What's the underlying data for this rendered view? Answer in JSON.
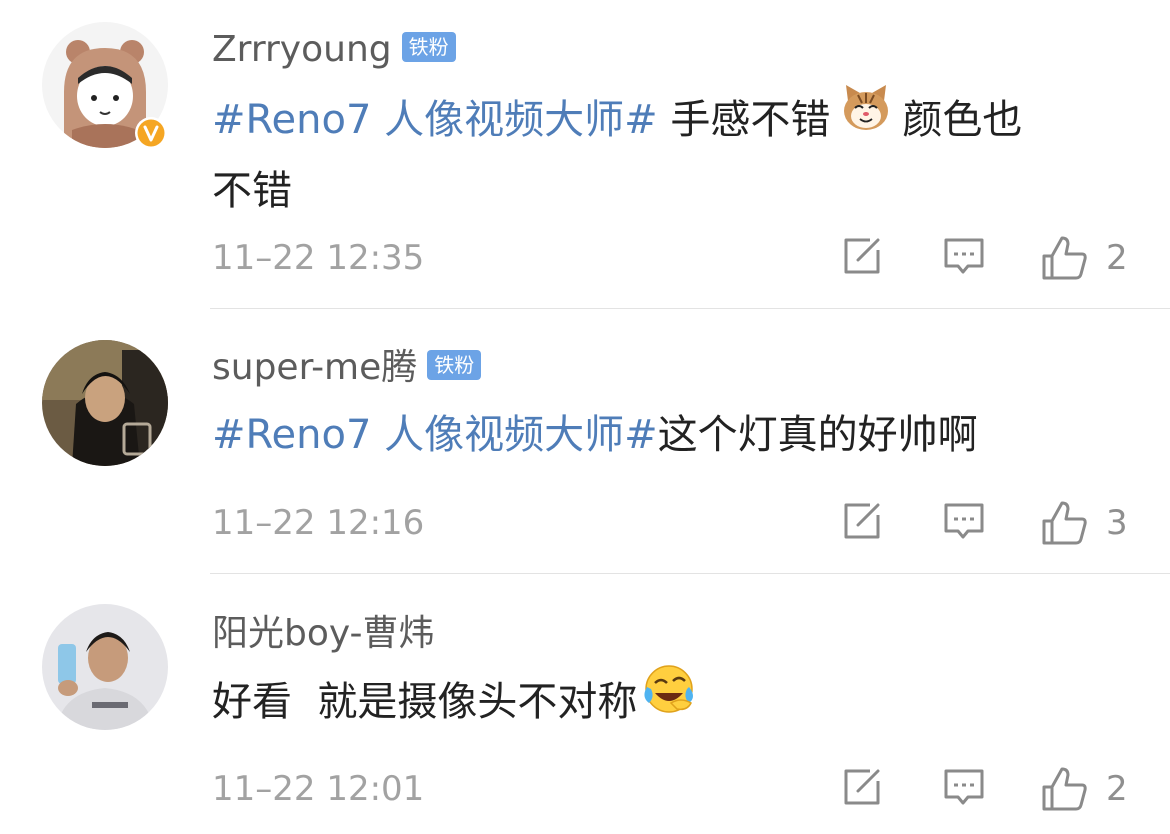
{
  "comments": [
    {
      "username": "Zrrryoung",
      "badge": "铁粉",
      "verified": true,
      "content_hashtag": "#Reno7 人像视频大师#",
      "content_line1_after": " 手感不错",
      "content_line1_end": "颜色也",
      "content_line2": "不错",
      "emoji": "cat-face-emoji",
      "time": "11–22 12:35",
      "likes": "2"
    },
    {
      "username": "super-me腾",
      "badge": "铁粉",
      "content_hashtag": "#Reno7 人像视频大师#",
      "content_text": "这个灯真的好帅啊",
      "time": "11–22 12:16",
      "likes": "3"
    },
    {
      "username": "阳光boy-曹炜",
      "content_text": "好看  就是摄像头不对称",
      "emoji": "crying-laughing-emoji",
      "time": "11–22 12:01",
      "likes": "2"
    }
  ],
  "colors": {
    "hashtag": "#4f7db8",
    "badge": "#6ca3e6",
    "verified": "#f5a623",
    "time": "#a2a2a2"
  },
  "icons": [
    "edit-icon",
    "comment-icon",
    "thumbs-up-icon"
  ]
}
